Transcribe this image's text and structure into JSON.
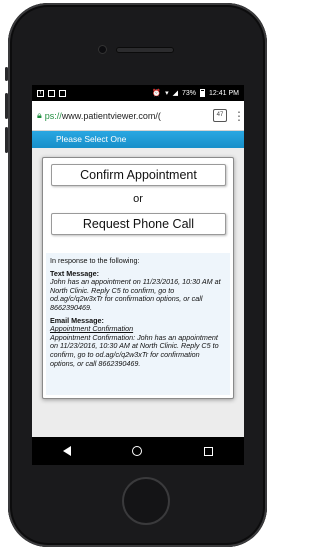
{
  "status_bar": {
    "battery_percent": "73%",
    "time": "12:41 PM",
    "left_icons": [
      "facebook-icon",
      "image-icon",
      "email-icon"
    ],
    "right_icons": [
      "alarm-icon",
      "wifi-icon",
      "signal-icon",
      "battery-icon"
    ]
  },
  "browser": {
    "url_prefix": "ps://",
    "url_rest": "www.patientviewer.com/(",
    "tab_count": "47"
  },
  "header": {
    "title": "Please Select One"
  },
  "dialog": {
    "confirm_label": "Confirm Appointment",
    "or_label": "or",
    "request_label": "Request Phone Call",
    "intro": "In response to the following:",
    "text_message_label": "Text Message:",
    "text_message_body": "John has an appointment on 11/23/2016, 10:30 AM at North Clinic. Reply C5 to confirm, go to od.ag/c/q2w3xTr for confirmation options, or call 8662390469.",
    "email_message_label": "Email Message:",
    "email_subject": "Appointment Confirmation",
    "email_body": "Appointment Confirmation: John has an appointment on 11/23/2016, 10:30 AM at North Clinic. Reply C5 to confirm, go to od.ag/c/q2w3xTr for confirmation options, or call 8662390469."
  },
  "colors": {
    "header_blue": "#1f9bd7",
    "info_bg": "#eef5fb",
    "lock_green": "#1e8e3e"
  }
}
